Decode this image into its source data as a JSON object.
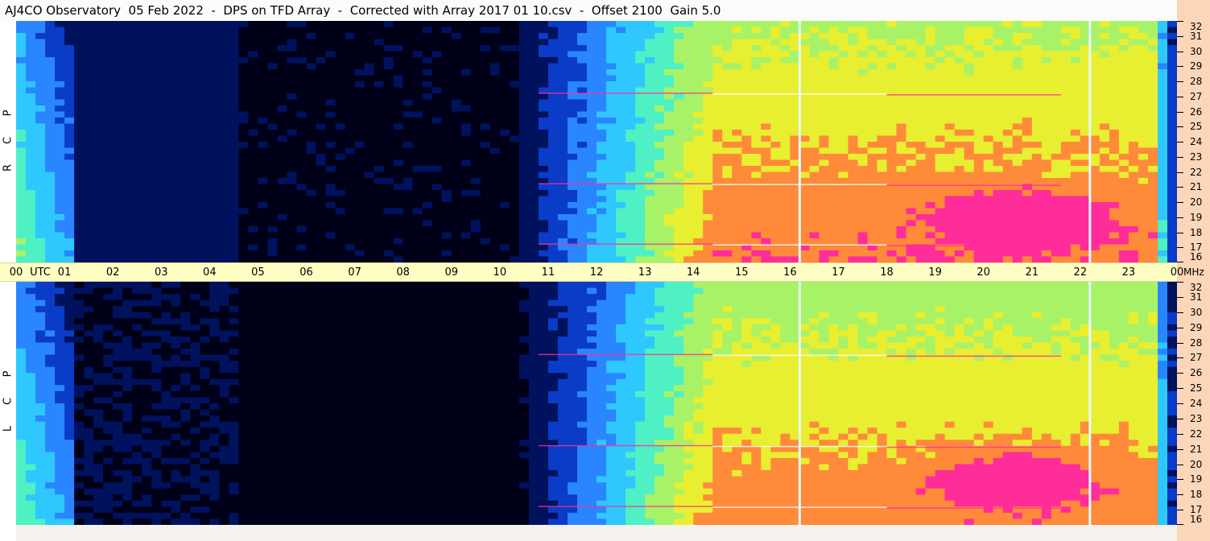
{
  "title": "AJ4CO Observatory  05 Feb 2022  -  DPS on TFD Array  -  Corrected with Array 2017 01 10.csv  -  Offset 2100  Gain 5.0",
  "chart_data": {
    "type": "heatmap",
    "title": "AJ4CO Observatory  05 Feb 2022  -  DPS on TFD Array  -  Corrected with Array 2017 01 10.csv  -  Offset 2100  Gain 5.0",
    "x_axis": {
      "unit_label": "UTC",
      "tick_labels": [
        "00",
        "01",
        "02",
        "03",
        "04",
        "05",
        "06",
        "07",
        "08",
        "09",
        "10",
        "11",
        "12",
        "13",
        "14",
        "15",
        "16",
        "17",
        "18",
        "19",
        "20",
        "21",
        "22",
        "23",
        "00"
      ],
      "range_hours": [
        0,
        24
      ]
    },
    "y_axis": {
      "unit_label": "MHz",
      "tick_labels": [
        "32",
        "31",
        "30",
        "29",
        "28",
        "27",
        "26",
        "25",
        "24",
        "23",
        "22",
        "21",
        "20",
        "19",
        "18",
        "17",
        "16"
      ],
      "range_mhz": [
        16,
        32
      ]
    },
    "panels": [
      {
        "name": "RCP",
        "letters": [
          "P",
          "C",
          "R"
        ]
      },
      {
        "name": "LCP",
        "letters": [
          "P",
          "C",
          "L"
        ]
      }
    ],
    "colormap": [
      "#000018",
      "#00125e",
      "#0a3cc8",
      "#2a86ff",
      "#2ec8ff",
      "#4ff0c4",
      "#a8f268",
      "#e8ee30",
      "#ff8a3a",
      "#ff2d9a",
      "#ffffff"
    ],
    "vertical_markers_hours": [
      16.2,
      22.2
    ],
    "interference_bands_mhz": [
      27.2,
      21.2,
      17.2
    ],
    "grid": false
  }
}
